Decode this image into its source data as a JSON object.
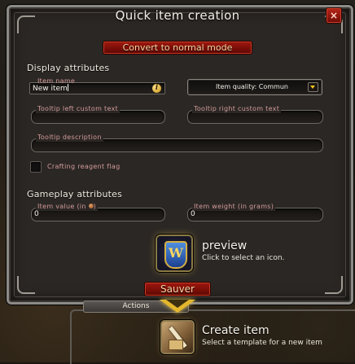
{
  "dialog": {
    "title": "Quick item creation",
    "close_label": "×",
    "convert_button": "Convert to normal mode",
    "save_button": "Sauver"
  },
  "display": {
    "section_label": "Display attributes",
    "item_name": {
      "label": "Item name",
      "value": "New item",
      "info_icon": "i"
    },
    "quality": {
      "label": "Item quality: Commun"
    },
    "tooltip_left": {
      "label": "Tooltip left custom text",
      "value": ""
    },
    "tooltip_right": {
      "label": "Tooltip right custom text",
      "value": ""
    },
    "tooltip_desc": {
      "label": "Tooltip description",
      "value": ""
    },
    "crafting_flag": {
      "label": "Crafting reagent flag",
      "checked": false
    }
  },
  "gameplay": {
    "section_label": "Gameplay attributes",
    "item_value": {
      "label_prefix": "Item value (in",
      "label_suffix": ")",
      "value": "0"
    },
    "item_weight": {
      "label": "Item weight (in grams)",
      "value": "0"
    }
  },
  "preview": {
    "title": "preview",
    "subtitle": "Click to select an icon.",
    "icon_glyph": "W"
  },
  "actions": {
    "tab_label": "Actions",
    "create_title": "Create item",
    "create_subtitle": "Select a template for a new item"
  },
  "colors": {
    "accent_red": "#a0180f",
    "label_pink": "#d19b9b",
    "gold": "#e3b62c"
  }
}
